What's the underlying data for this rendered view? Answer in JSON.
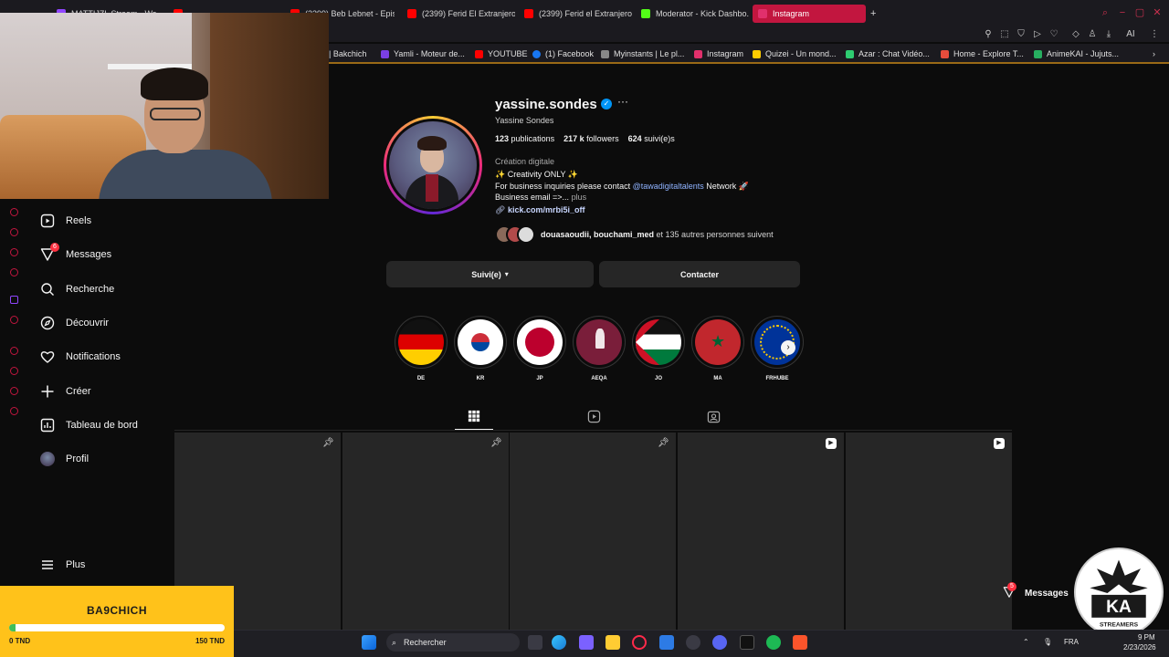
{
  "browser": {
    "tabs": [
      {
        "label": "MATTIJZL Stream - Wa...",
        "color": "#9146ff",
        "active": false
      },
      {
        "label": "...",
        "color": "#ff0000",
        "active": false
      },
      {
        "label": "(2399) Beb Lebnet - Episo...",
        "color": "#ff0000",
        "active": false
      },
      {
        "label": "(2399) Ferid El Extranjero",
        "color": "#ff0000",
        "active": false
      },
      {
        "label": "(2399) Ferid el Extranjero",
        "color": "#ff0000",
        "active": false
      },
      {
        "label": "Moderator - Kick Dashbo...",
        "color": "#53fc18",
        "active": false
      },
      {
        "label": "Instagram",
        "color": "#e1306c",
        "active": true
      }
    ],
    "new_tab": "+",
    "bookmarks": [
      {
        "label": "| Bakchich",
        "color": "#444444"
      },
      {
        "label": "Yamli - Moteur de...",
        "color": "#7b3fe4"
      },
      {
        "label": "YOUTUBE",
        "color": "#ff0000"
      },
      {
        "label": "(1) Facebook",
        "color": "#1877f2"
      },
      {
        "label": "Myinstants | Le pl...",
        "color": "#888888"
      },
      {
        "label": "Instagram",
        "color": "#e1306c"
      },
      {
        "label": "Quizei - Un mond...",
        "color": "#ffcc00"
      },
      {
        "label": "Azar : Chat Vidéo...",
        "color": "#2ecc71"
      },
      {
        "label": "Home - Explore T...",
        "color": "#e74c3c"
      },
      {
        "label": "AnimeKAI - Jujuts...",
        "color": "#27ae60"
      }
    ],
    "toolbar_ai": "AI"
  },
  "sidebar": {
    "items": [
      {
        "label": "Reels",
        "icon": "reels-icon"
      },
      {
        "label": "Messages",
        "icon": "messages-icon",
        "badge": "6"
      },
      {
        "label": "Recherche",
        "icon": "search-icon"
      },
      {
        "label": "Découvrir",
        "icon": "compass-icon"
      },
      {
        "label": "Notifications",
        "icon": "heart-icon"
      },
      {
        "label": "Créer",
        "icon": "plus-icon"
      },
      {
        "label": "Tableau de bord",
        "icon": "dashboard-icon"
      },
      {
        "label": "Profil",
        "icon": "profile-avatar"
      }
    ],
    "more": "Plus"
  },
  "profile": {
    "username": "yassine.sondes",
    "more": "···",
    "full_name": "Yassine Sondes",
    "stats": {
      "posts_count": "123",
      "posts_label": "publications",
      "followers_count": "217 k",
      "followers_label": "followers",
      "following_count": "624",
      "following_label": "suivi(e)s"
    },
    "category": "Création digitale",
    "bio_line1": "✨ Creativity ONLY ✨",
    "bio_line2_prefix": "For business inquiries please contact ",
    "bio_mention": "@tawadigitaltalents",
    "bio_line2_suffix": " Network 🚀",
    "bio_line3": "Business email =>...",
    "bio_more": "plus",
    "link": "kick.com/mrbi5i_off",
    "followed_by_names": "douasaoudii, bouchami_med",
    "followed_by_rest": " et 135 autres personnes suivent"
  },
  "actions": {
    "following": "Suivi(e)",
    "contact": "Contacter"
  },
  "highlights": [
    {
      "label": "DE"
    },
    {
      "label": "KR"
    },
    {
      "label": "JP"
    },
    {
      "label": "AEQA"
    },
    {
      "label": "JO"
    },
    {
      "label": "MA"
    },
    {
      "label": "FRHUBE"
    }
  ],
  "donation": {
    "title": "BA9CHICH",
    "min": "0 TND",
    "max": "150 TND",
    "progress": 0.03
  },
  "floating_messages": {
    "label": "Messages",
    "badge": "5"
  },
  "logo": {
    "text": "KA",
    "subtext": "STREAMERS"
  },
  "taskbar": {
    "search": "Rechercher",
    "lang": "FRA",
    "time": "9 PM",
    "date": "2/23/2026"
  }
}
